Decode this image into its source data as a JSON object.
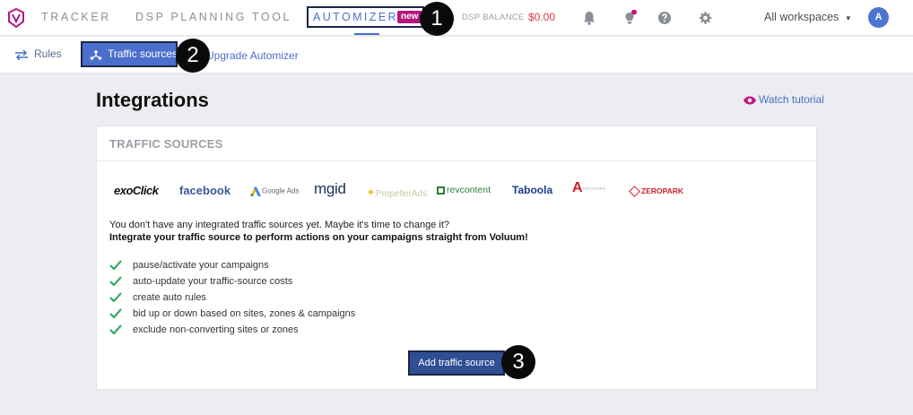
{
  "nav": {
    "tracker": "TRACKER",
    "dsp_planning": "DSP PLANNING TOOL",
    "automizer": "AUTOMIZER",
    "new_badge": "new",
    "dsp_balance_label": "DSP BALANCE",
    "dsp_balance_value": "$0.00",
    "workspaces": "All workspaces",
    "avatar_initial": "A"
  },
  "subnav": {
    "rules": "Rules",
    "traffic_sources": "Traffic sources",
    "upgrade": "Upgrade Automizer"
  },
  "markers": [
    "1",
    "2",
    "3"
  ],
  "main": {
    "title": "Integrations",
    "watch_tutorial": "Watch tutorial",
    "card_header": "TRAFFIC SOURCES",
    "logos": [
      "exoClick",
      "facebook",
      "Google Ads",
      "mgid",
      "PropellerAds",
      "revcontent",
      "Taboola",
      "ADSTERRA",
      "ZEROPARK"
    ],
    "intro": "You don't have any integrated traffic sources yet. Maybe it's time to change it?",
    "intro_bold": "Integrate your traffic source to perform actions on your campaigns straight from Voluum!",
    "features": [
      "pause/activate your campaigns",
      "auto-update your traffic-source costs",
      "create auto rules",
      "bid up or down based on sites, zones & campaigns",
      "exclude non-converting sites or zones"
    ],
    "add_button": "Add traffic source"
  },
  "colors": {
    "accent": "#4a6fc9",
    "button_dark": "#2f4e93",
    "badge": "#b5167f",
    "balance": "#e0394a",
    "check": "#2fae5a"
  }
}
